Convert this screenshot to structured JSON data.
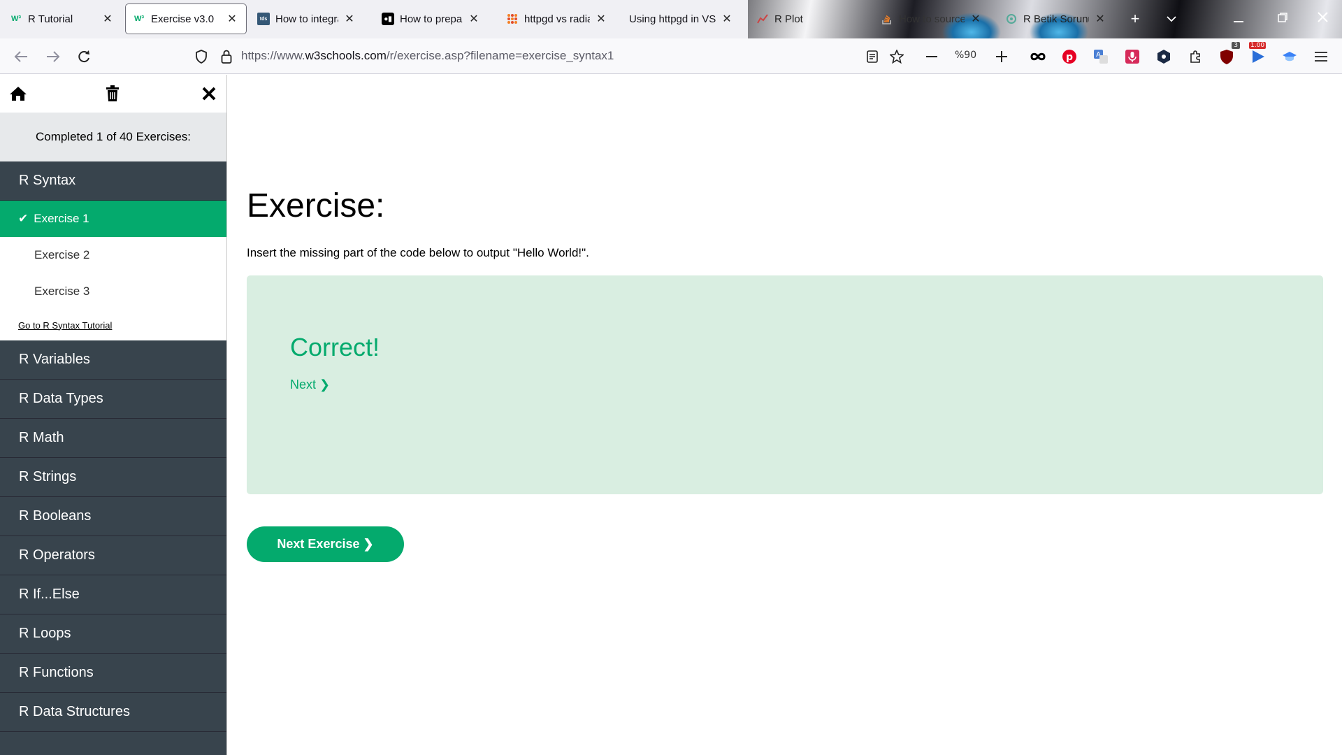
{
  "browser": {
    "tabs": [
      {
        "title": "R Tutorial",
        "favicon": "w3schools-logo"
      },
      {
        "title": "Exercise v3.0",
        "favicon": "w3schools-logo"
      },
      {
        "title": "How to integra",
        "favicon": "tds-logo"
      },
      {
        "title": "How to prepare",
        "favicon": "medium-logo"
      },
      {
        "title": "httpgd vs radian",
        "favicon": "grid-logo"
      },
      {
        "title": "Using httpgd in VSC",
        "favicon": ""
      },
      {
        "title": "R Plot",
        "favicon": "chart-icon"
      },
      {
        "title": "How to source",
        "favicon": "stackoverflow-logo"
      },
      {
        "title": "R Betik Sorunu",
        "favicon": "chatgpt-logo"
      }
    ],
    "close_glyph": "✕",
    "new_tab_glyph": "+",
    "url_prefix": "https://www.",
    "url_host": "w3schools.com",
    "url_path": "/r/exercise.asp?filename=exercise_syntax1",
    "zoom_label": "%90",
    "badges": {
      "ublock": "3",
      "video": "1.00"
    }
  },
  "sidebar": {
    "progress_text": "Completed 1 of 40 Exercises:",
    "current_category": "R Syntax",
    "exercises": [
      {
        "label": "Exercise 1",
        "done": true
      },
      {
        "label": "Exercise 2",
        "done": false
      },
      {
        "label": "Exercise 3",
        "done": false
      }
    ],
    "tutorial_link": "Go to R Syntax Tutorial",
    "categories": [
      "R Variables",
      "R Data Types",
      "R Math",
      "R Strings",
      "R Booleans",
      "R Operators",
      "R If...Else",
      "R Loops",
      "R Functions",
      "R Data Structures"
    ]
  },
  "main": {
    "title": "Exercise:",
    "description": "Insert the missing part of the code below to output \"Hello World!\".",
    "result_text": "Correct!",
    "next_link": "Next ❯",
    "next_button": "Next Exercise ❯"
  },
  "colors": {
    "accent": "#04aa6d",
    "result_bg": "#d9eee1",
    "sidebar_dark": "#38444d"
  }
}
